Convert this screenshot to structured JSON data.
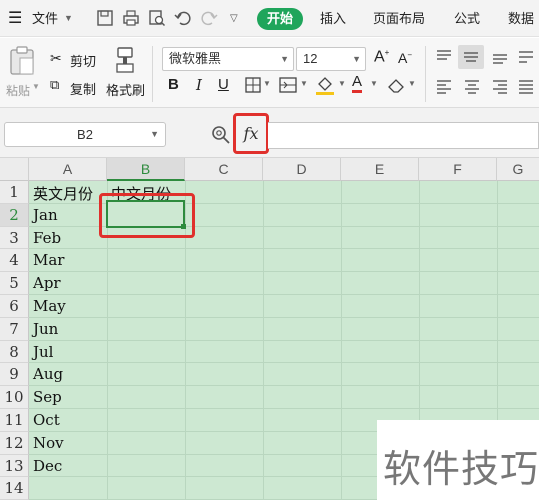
{
  "menu": {
    "file": "文件",
    "start": "开始",
    "insert": "插入",
    "page_layout": "页面布局",
    "formula": "公式",
    "data": "数据"
  },
  "ribbon": {
    "paste": "粘贴",
    "cut": "剪切",
    "copy": "复制",
    "format_painter": "格式刷",
    "font_name": "微软雅黑",
    "font_size": "12",
    "bold": "B",
    "italic": "I",
    "underline": "U",
    "font_color_letter": "A",
    "grow_font": "A",
    "shrink_font": "A"
  },
  "formula_bar": {
    "name_box": "B2",
    "fx": "fx",
    "formula": ""
  },
  "sheet": {
    "columns": [
      "A",
      "B",
      "C",
      "D",
      "E",
      "F",
      "G"
    ],
    "rows": [
      "1",
      "2",
      "3",
      "4",
      "5",
      "6",
      "7",
      "8",
      "9",
      "10",
      "11",
      "12",
      "13",
      "14"
    ],
    "active_cell": "B2",
    "cells": {
      "A1": "英文月份",
      "B1": "中文月份",
      "A2": "Jan",
      "A3": "Feb",
      "A4": "Mar",
      "A5": "Apr",
      "A6": "May",
      "A7": "Jun",
      "A8": "Jul",
      "A9": "Aug",
      "A10": "Sep",
      "A11": "Oct",
      "A12": "Nov",
      "A13": "Dec"
    },
    "fill_color": "#cde8d2"
  },
  "colors": {
    "accent": "#1fa55b",
    "highlight": "#e0302c",
    "active_border": "#2e8b3e"
  },
  "watermark": "软件技巧"
}
